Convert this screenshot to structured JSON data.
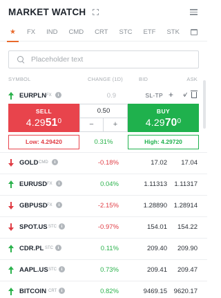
{
  "header": {
    "title": "MARKET WATCH"
  },
  "tabs": [
    {
      "label": "★",
      "active": true
    },
    {
      "label": "FX"
    },
    {
      "label": "IND"
    },
    {
      "label": "CMD"
    },
    {
      "label": "CRT"
    },
    {
      "label": "STC"
    },
    {
      "label": "ETF"
    },
    {
      "label": "STK"
    }
  ],
  "search": {
    "placeholder": "Placeholder text",
    "value": ""
  },
  "columns": {
    "symbol": "SYMBOL",
    "change": "CHANGE (1D)",
    "bid": "BID",
    "ask": "ASK"
  },
  "expanded": {
    "symbol": "EURPLN",
    "class": "FX",
    "change": "0.9",
    "sltp": "SL-TP",
    "sell_label": "SELL",
    "sell_price_a": "4.29",
    "sell_price_b": "51",
    "sell_price_c": "0",
    "buy_label": "BUY",
    "buy_price_a": "4.29",
    "buy_price_b": "70",
    "buy_price_c": "0",
    "volume": "0.50",
    "minus": "−",
    "plus": "+",
    "low": "Low: 4.29420",
    "high": "High: 4.29720",
    "spread": "0.31%"
  },
  "rows": [
    {
      "symbol": "GOLD",
      "class": "CMD",
      "direction": "down",
      "change": "-0.18%",
      "bid": "17.02",
      "ask": "17.04"
    },
    {
      "symbol": "EURUSD",
      "class": "FX",
      "direction": "up",
      "change": "0.04%",
      "bid": "1.11313",
      "ask": "1.11317"
    },
    {
      "symbol": "GBPUSD",
      "class": "FX",
      "direction": "down",
      "change": "-2.15%",
      "bid": "1.28890",
      "ask": "1.28914"
    },
    {
      "symbol": "SPOT.US",
      "class": "STC",
      "direction": "down",
      "change": "-0.97%",
      "bid": "154.01",
      "ask": "154.22"
    },
    {
      "symbol": "CDR.PL",
      "class": "STC",
      "direction": "up",
      "change": "0.11%",
      "bid": "209.40",
      "ask": "209.90"
    },
    {
      "symbol": "AAPL.US",
      "class": "STC",
      "direction": "up",
      "change": "0.73%",
      "bid": "209.41",
      "ask": "209.47"
    },
    {
      "symbol": "BITCOIN",
      "class": "CRT",
      "direction": "up",
      "change": "0.82%",
      "bid": "9469.15",
      "ask": "9620.17"
    }
  ],
  "colors": {
    "accent": "#e8692b",
    "up": "#2bb24c",
    "down": "#e03c44",
    "sell": "#e8444c",
    "buy": "#1fb14d"
  },
  "icons": [
    "expand-icon",
    "list-view-icon",
    "calendar-icon",
    "search-icon",
    "info-icon",
    "plus-icon",
    "multi-order-icon",
    "trash-icon",
    "arrow-up-icon",
    "arrow-down-icon"
  ]
}
